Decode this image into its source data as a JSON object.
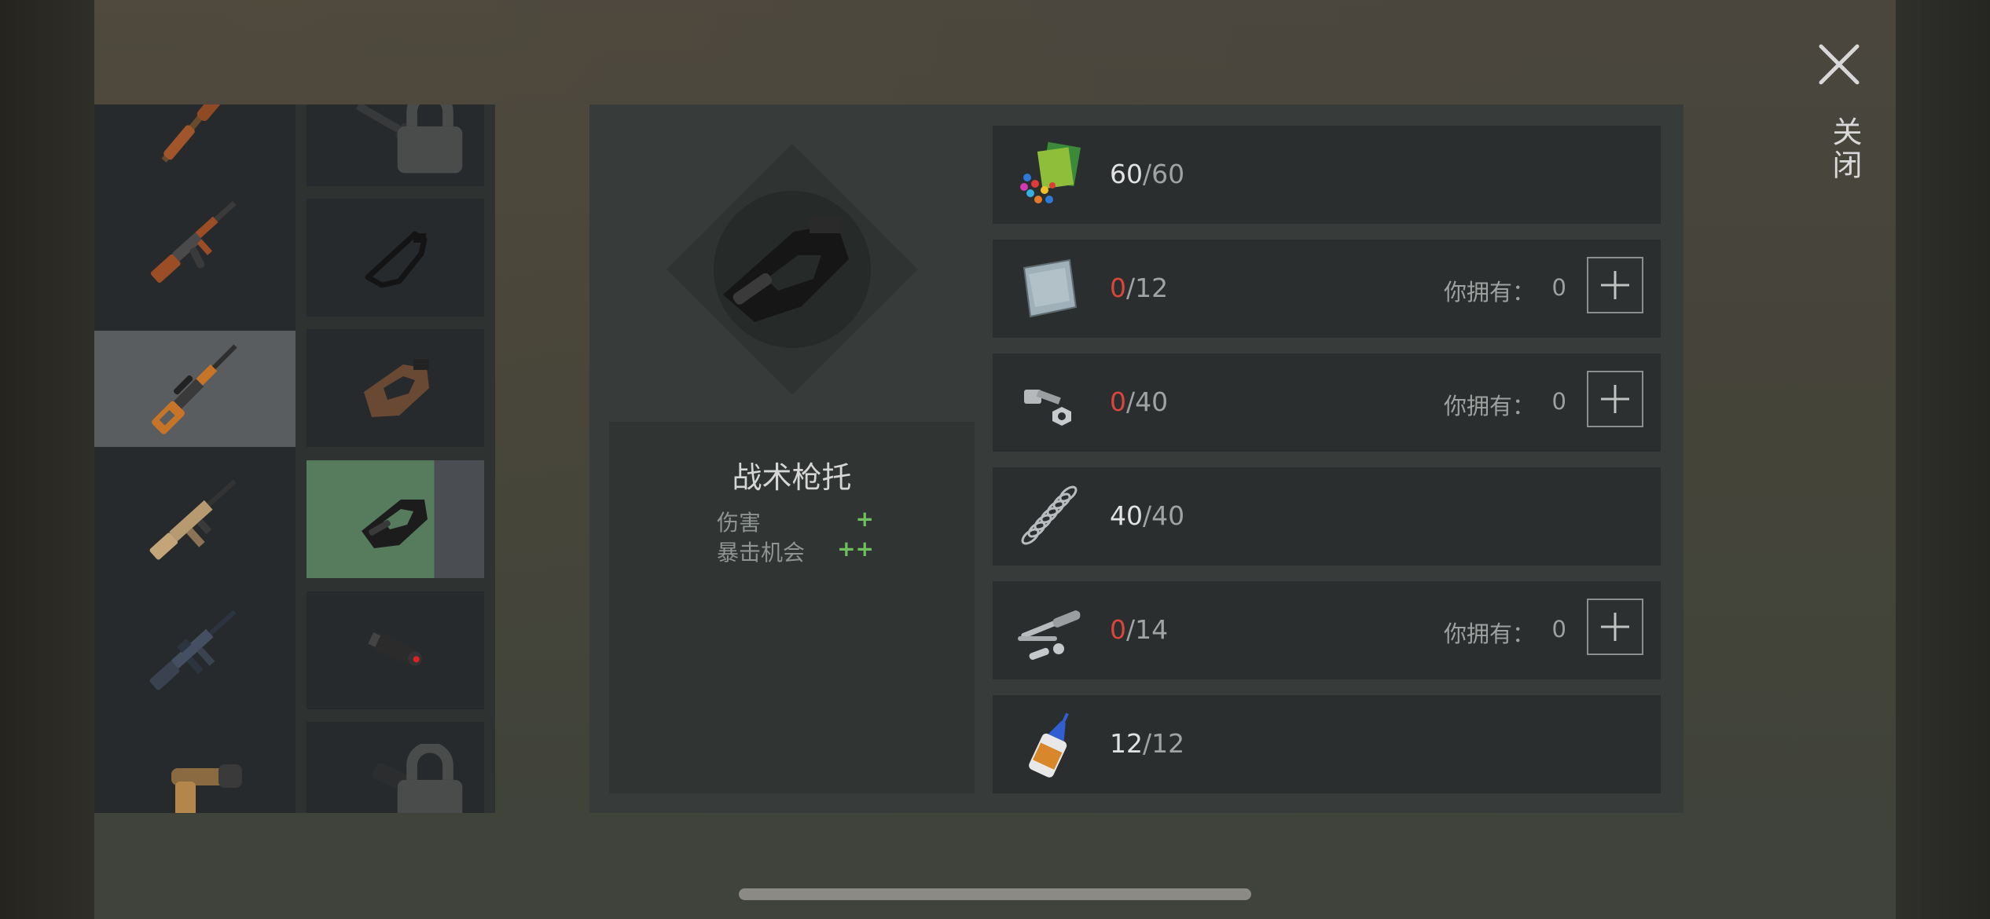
{
  "close": {
    "label": "关闭"
  },
  "item": {
    "name": "战术枪托",
    "stats": [
      {
        "label": "伤害",
        "value": "+"
      },
      {
        "label": "暴击机会",
        "value": "++"
      }
    ]
  },
  "resources": [
    {
      "icon": "plastic-pellets-icon",
      "have": "60",
      "need": "/60",
      "insufficient": false,
      "owned_label": "",
      "owned": ""
    },
    {
      "icon": "metal-sheet-icon",
      "have": "0",
      "need": "/12",
      "insufficient": true,
      "owned_label": "你拥有：",
      "owned": "0"
    },
    {
      "icon": "bolt-nut-icon",
      "have": "0",
      "need": "/40",
      "insufficient": true,
      "owned_label": "你拥有：",
      "owned": "0"
    },
    {
      "icon": "spring-icon",
      "have": "40",
      "need": "/40",
      "insufficient": false,
      "owned_label": "",
      "owned": ""
    },
    {
      "icon": "gun-parts-icon",
      "have": "0",
      "need": "/14",
      "insufficient": true,
      "owned_label": "你拥有：",
      "owned": "0"
    },
    {
      "icon": "glue-bottle-icon",
      "have": "12",
      "need": "/12",
      "insufficient": false,
      "owned_label": "",
      "owned": ""
    }
  ],
  "colors": {
    "insufficient": "#d8463c",
    "stat_positive": "#6fbf5f",
    "active_attachment": "#567b5d"
  },
  "weapons": [
    "lever-rifle-icon",
    "ak-rifle-icon",
    "dragunov-rifle-icon",
    "scar-rifle-icon",
    "m16-rifle-icon",
    "flare-gun-icon"
  ],
  "attachments": [
    "locked-barrel-icon",
    "folding-stock-icon",
    "wooden-stock-icon",
    "tactical-stock-icon",
    "laser-sight-icon",
    "locked-scope-icon"
  ]
}
